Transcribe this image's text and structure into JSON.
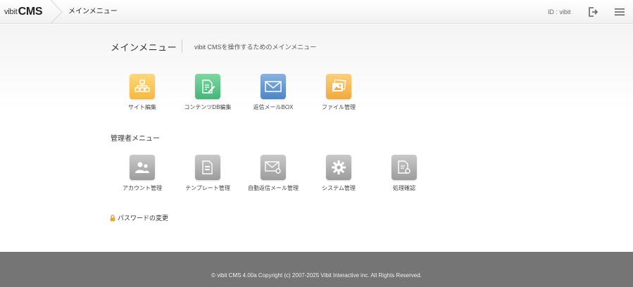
{
  "header": {
    "logo_small": "vibit",
    "logo_big": "CMS",
    "breadcrumb": "メインメニュー",
    "user_id": "ID : vibit"
  },
  "main": {
    "title": "メインメニュー",
    "description": "vibit CMSを操作するためのメインメニュー",
    "tiles": [
      {
        "label": "サイト編集",
        "icon": "sitemap-icon",
        "color": "#f7b93b"
      },
      {
        "label": "コンテンツDB編集",
        "icon": "document-edit-icon",
        "color": "#44b778"
      },
      {
        "label": "返信メールBOX",
        "icon": "mail-icon",
        "color": "#4c86c6"
      },
      {
        "label": "ファイル管理",
        "icon": "image-files-icon",
        "color": "#f2a93a"
      }
    ],
    "admin_section_title": "管理者メニュー",
    "admin_tiles": [
      {
        "label": "アカウント管理",
        "icon": "users-icon"
      },
      {
        "label": "テンプレート管理",
        "icon": "template-icon"
      },
      {
        "label": "自動返信メール管理",
        "icon": "mail-settings-icon"
      },
      {
        "label": "システム管理",
        "icon": "gear-icon"
      },
      {
        "label": "処理確認",
        "icon": "document-settings-icon"
      }
    ],
    "password_link": "パスワードの変更"
  },
  "footer": {
    "copyright": "© vibit CMS 4.00a Copyright (c) 2007-2025 Vibit Interactive inc. All Rights Reserved."
  }
}
